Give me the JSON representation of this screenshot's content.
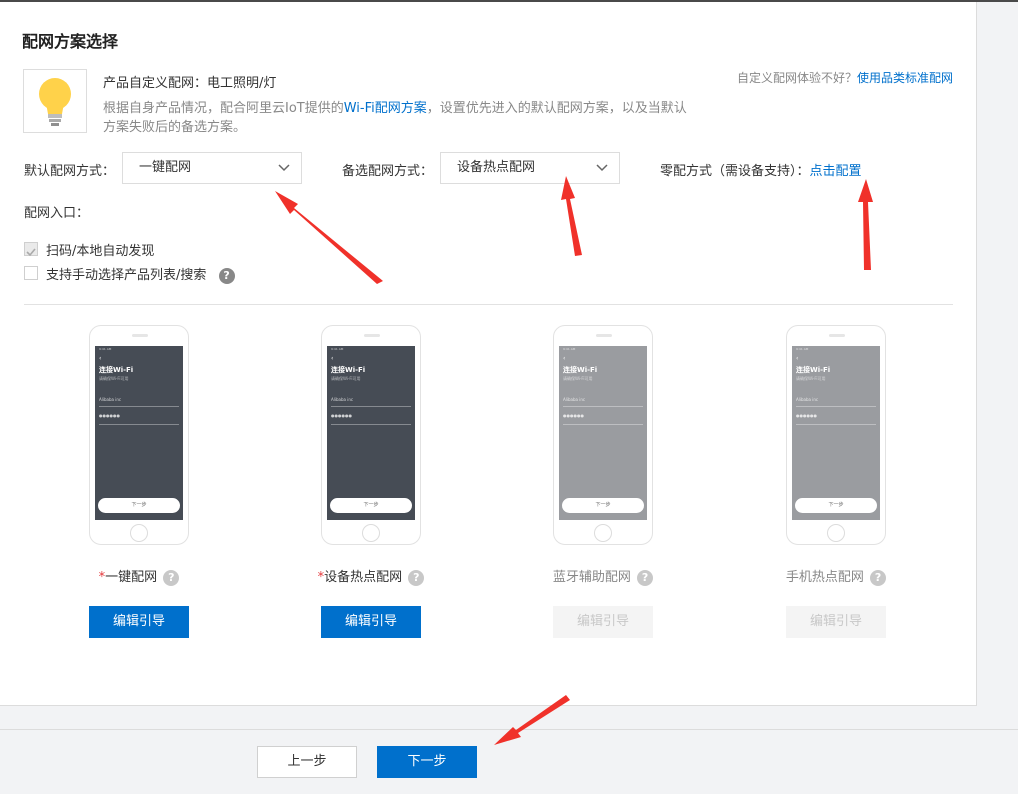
{
  "header": {
    "title": "配网方案选择"
  },
  "product": {
    "prefix": "产品自定义配网：",
    "name": "电工照明/灯",
    "desc_before": "根据自身产品情况，配合阿里云IoT提供的",
    "desc_link": "Wi-Fi配网方案",
    "desc_after": "，设置优先进入的默认配网方案，以及当默认方案失败后的备选方案。"
  },
  "std_link": {
    "prompt": "自定义配网体验不好？",
    "link": "使用品类标准配网"
  },
  "default_method": {
    "label": "默认配网方式：",
    "value": "一键配网"
  },
  "backup_method": {
    "label": "备选配网方式：",
    "value": "设备热点配网"
  },
  "zero_config": {
    "label": "零配方式（需设备支持）：",
    "link": "点击配置"
  },
  "entry": {
    "label": "配网入口：",
    "options": [
      {
        "label": "扫码/本地自动发现",
        "checked": true
      },
      {
        "label": "支持手动选择产品列表/搜索",
        "checked": false
      }
    ]
  },
  "help_glyph": "?",
  "phone_screen": {
    "status": "9:41 AM",
    "back": "‹",
    "title": "连接Wi-Fi",
    "subtitle": "请确保Wi-Fi可用",
    "ssid": "Alibaba inc",
    "password": "●●●●●●",
    "next": "下一步"
  },
  "cards": [
    {
      "label": "一键配网",
      "required": "*",
      "button": "编辑引导",
      "enabled": true
    },
    {
      "label": "设备热点配网",
      "required": "*",
      "button": "编辑引导",
      "enabled": true
    },
    {
      "label": "蓝牙辅助配网",
      "required": "",
      "button": "编辑引导",
      "enabled": false
    },
    {
      "label": "手机热点配网",
      "required": "",
      "button": "编辑引导",
      "enabled": false
    }
  ],
  "footer": {
    "prev": "上一步",
    "next": "下一步"
  },
  "colors": {
    "primary": "#0070cc",
    "arrow": "#f0312a",
    "screen_dark": "#464c55",
    "screen_gray": "#9a9ca0"
  }
}
